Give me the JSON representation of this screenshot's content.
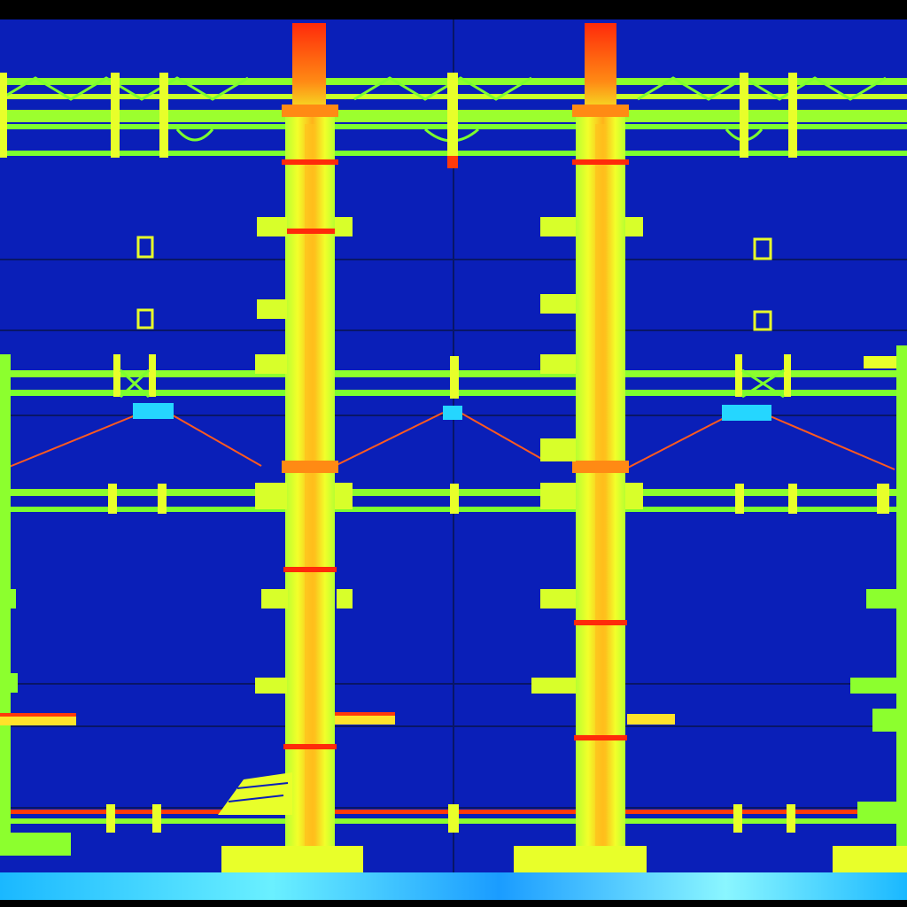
{
  "scene": {
    "kind": "structural stress heatmap render",
    "legend_text": "",
    "colors": {
      "background": "#0a1fb8",
      "frame": "#000000",
      "grid_line": "#0a1870",
      "low": "#7cff2e",
      "mid": "#e8ff2a",
      "high": "#ff7a10",
      "peak": "#ff1e0a",
      "cool": "#25d6ff",
      "cable": "#ff5a1e"
    },
    "icons": {
      "column": "tower-column",
      "beam": "horizontal-truss",
      "bracket": "bracket-fitting",
      "cable": "tension-cable",
      "base": "base-plinth"
    },
    "columns": [
      {
        "name": "left-main-column"
      },
      {
        "name": "right-main-column"
      }
    ],
    "beams": [
      {
        "name": "top-truss"
      },
      {
        "name": "upper-mid-beam"
      },
      {
        "name": "lower-mid-beam"
      },
      {
        "name": "bottom-beam"
      }
    ]
  }
}
